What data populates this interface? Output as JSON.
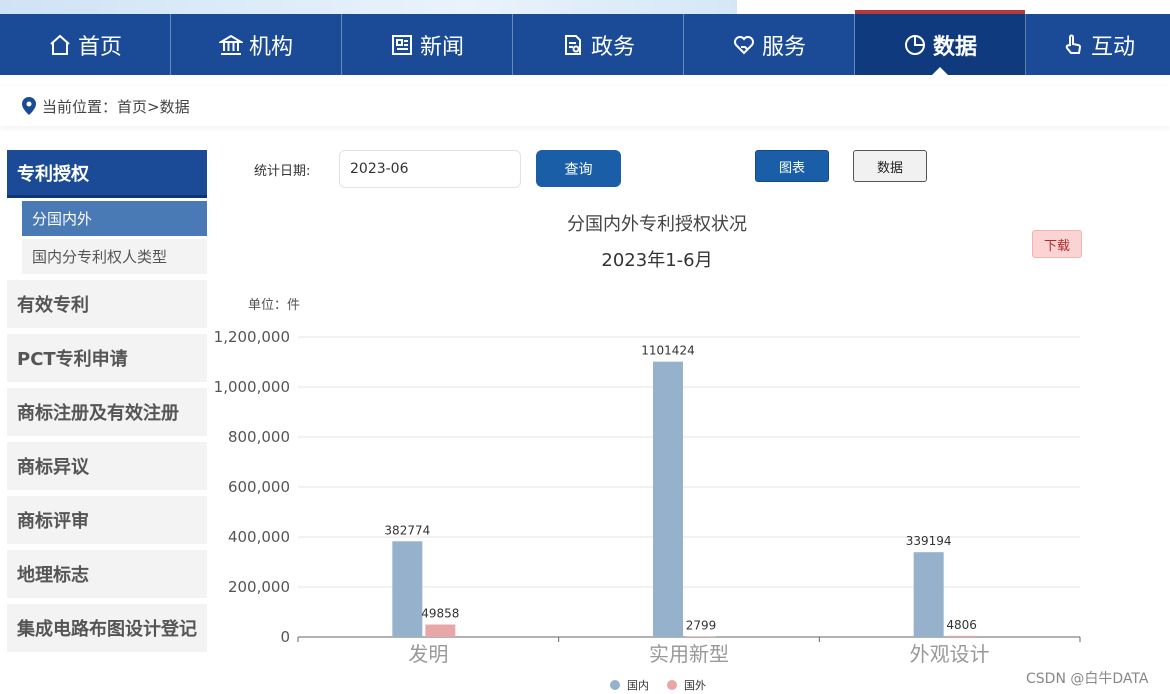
{
  "nav": {
    "items": [
      {
        "label": "首页",
        "icon": "home-icon"
      },
      {
        "label": "机构",
        "icon": "institution-icon"
      },
      {
        "label": "新闻",
        "icon": "news-icon"
      },
      {
        "label": "政务",
        "icon": "document-icon"
      },
      {
        "label": "服务",
        "icon": "heart-hand-icon"
      },
      {
        "label": "数据",
        "icon": "pie-chart-icon",
        "active": true
      },
      {
        "label": "互动",
        "icon": "pointer-hand-icon"
      }
    ]
  },
  "breadcrumb": {
    "text": "当前位置：首页>数据"
  },
  "sidebar": {
    "head": "专利授权",
    "subs": [
      "分国内外",
      "国内分专利权人类型"
    ],
    "items": [
      "有效专利",
      "PCT专利申请",
      "商标注册及有效注册",
      "商标异议",
      "商标评审",
      "地理标志",
      "集成电路布图设计登记"
    ]
  },
  "filter": {
    "label": "统计日期:",
    "date_value": "2023-06",
    "query_label": "查询",
    "chart_label": "图表",
    "data_label": "数据",
    "download_label": "下载"
  },
  "unit": "单位：件",
  "watermark": "CSDN @白牛DATA",
  "colors": {
    "domestic": "#96b1cc",
    "foreign": "#e8a7a7",
    "nav": "#1b4b97"
  },
  "chart_data": {
    "type": "bar",
    "title": "分国内外专利授权状况",
    "subtitle": "2023年1-6月",
    "categories": [
      "发明",
      "实用新型",
      "外观设计"
    ],
    "series": [
      {
        "name": "国内",
        "values": [
          382774,
          1101424,
          339194
        ]
      },
      {
        "name": "国外",
        "values": [
          49858,
          2799,
          4806
        ]
      }
    ],
    "ylim": [
      0,
      1200000
    ],
    "yticks": [
      "0",
      "200,000",
      "400,000",
      "600,000",
      "800,000",
      "1,000,000",
      "1,200,000"
    ],
    "grid": true,
    "legend": "bottom-center"
  }
}
